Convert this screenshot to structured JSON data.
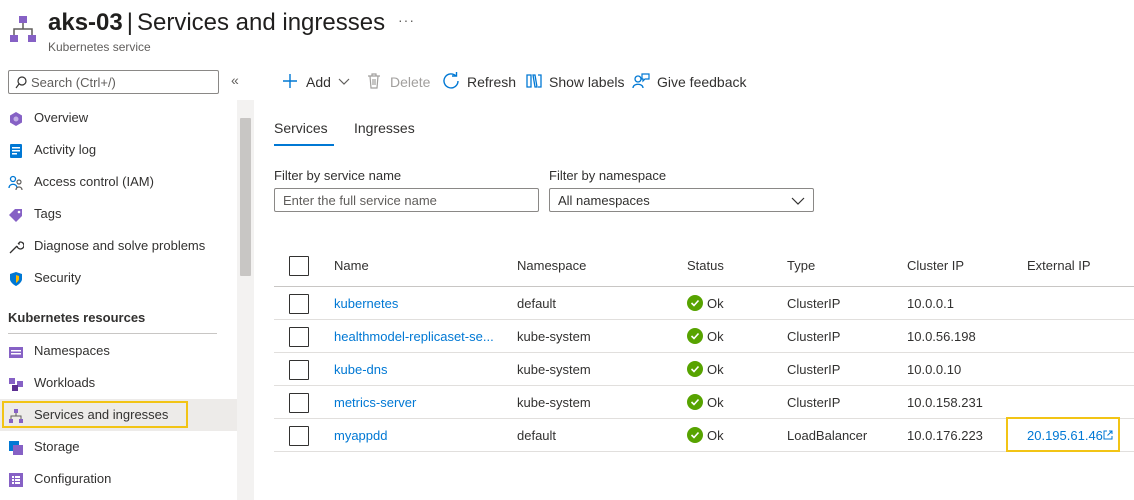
{
  "header": {
    "resource_name": "aks-03",
    "separator": "|",
    "page_title": "Services and ingresses",
    "subtitle": "Kubernetes service",
    "more_label": "···"
  },
  "sidebar": {
    "search_placeholder": "Search (Ctrl+/)",
    "collapse_label": "«",
    "items": [
      {
        "label": "Overview",
        "icon": "overview-icon"
      },
      {
        "label": "Activity log",
        "icon": "activity-log-icon"
      },
      {
        "label": "Access control (IAM)",
        "icon": "iam-icon"
      },
      {
        "label": "Tags",
        "icon": "tag-icon"
      },
      {
        "label": "Diagnose and solve problems",
        "icon": "wrench-icon"
      },
      {
        "label": "Security",
        "icon": "shield-icon"
      }
    ],
    "section_title": "Kubernetes resources",
    "resource_items": [
      {
        "label": "Namespaces",
        "icon": "namespaces-icon"
      },
      {
        "label": "Workloads",
        "icon": "workloads-icon"
      },
      {
        "label": "Services and ingresses",
        "icon": "services-icon",
        "selected": true
      },
      {
        "label": "Storage",
        "icon": "storage-icon"
      },
      {
        "label": "Configuration",
        "icon": "configuration-icon"
      }
    ]
  },
  "toolbar": {
    "add_label": "Add",
    "delete_label": "Delete",
    "refresh_label": "Refresh",
    "show_labels_label": "Show labels",
    "feedback_label": "Give feedback"
  },
  "tabs": {
    "services": "Services",
    "ingresses": "Ingresses",
    "active": "Services"
  },
  "filters": {
    "service_name_label": "Filter by service name",
    "service_name_placeholder": "Enter the full service name",
    "namespace_label": "Filter by namespace",
    "namespace_value": "All namespaces"
  },
  "table": {
    "columns": [
      "Name",
      "Namespace",
      "Status",
      "Type",
      "Cluster IP",
      "External IP"
    ],
    "rows": [
      {
        "name": "kubernetes",
        "namespace": "default",
        "status": "Ok",
        "type": "ClusterIP",
        "cluster_ip": "10.0.0.1",
        "external_ip": ""
      },
      {
        "name": "healthmodel-replicaset-se...",
        "namespace": "kube-system",
        "status": "Ok",
        "type": "ClusterIP",
        "cluster_ip": "10.0.56.198",
        "external_ip": ""
      },
      {
        "name": "kube-dns",
        "namespace": "kube-system",
        "status": "Ok",
        "type": "ClusterIP",
        "cluster_ip": "10.0.0.10",
        "external_ip": ""
      },
      {
        "name": "metrics-server",
        "namespace": "kube-system",
        "status": "Ok",
        "type": "ClusterIP",
        "cluster_ip": "10.0.158.231",
        "external_ip": ""
      },
      {
        "name": "myappdd",
        "namespace": "default",
        "status": "Ok",
        "type": "LoadBalancer",
        "cluster_ip": "10.0.176.223",
        "external_ip": "20.195.61.46"
      }
    ]
  },
  "colors": {
    "accent": "#0078d4",
    "highlight": "#f2c415",
    "ok_green": "#57a300"
  }
}
